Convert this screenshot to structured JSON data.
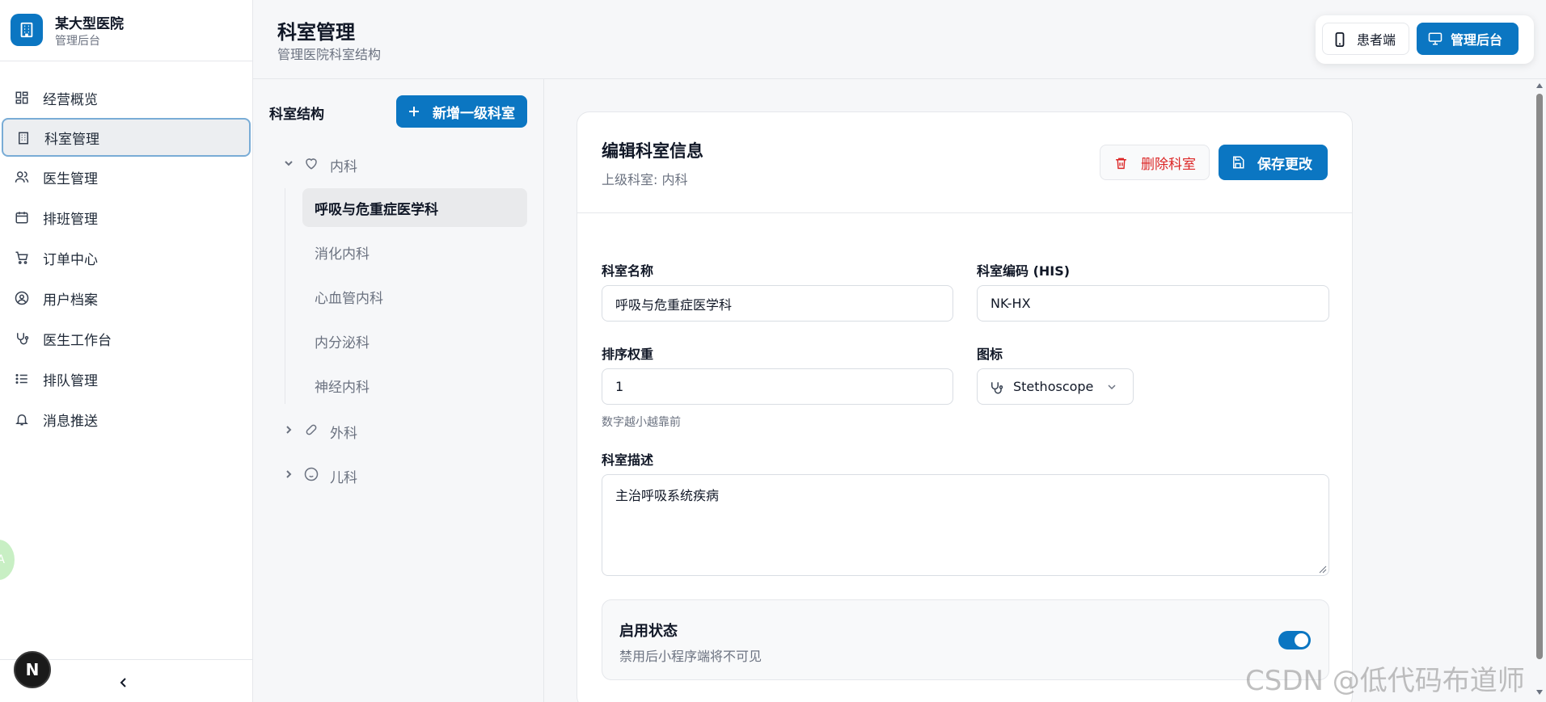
{
  "brand": {
    "title": "某大型医院",
    "subtitle": "管理后台"
  },
  "sidebar": {
    "items": [
      {
        "label": "经营概览",
        "icon": "dashboard-icon",
        "active": false
      },
      {
        "label": "科室管理",
        "icon": "building-icon",
        "active": true
      },
      {
        "label": "医生管理",
        "icon": "users-icon",
        "active": false
      },
      {
        "label": "排班管理",
        "icon": "calendar-icon",
        "active": false
      },
      {
        "label": "订单中心",
        "icon": "cart-icon",
        "active": false
      },
      {
        "label": "用户档案",
        "icon": "user-circle-icon",
        "active": false
      },
      {
        "label": "医生工作台",
        "icon": "stethoscope-icon",
        "active": false
      },
      {
        "label": "排队管理",
        "icon": "list-icon",
        "active": false
      },
      {
        "label": "消息推送",
        "icon": "bell-icon",
        "active": false
      }
    ],
    "collapse_glyph": "‹",
    "next_badge": "N"
  },
  "header": {
    "title": "科室管理",
    "subtitle": "管理医院科室结构",
    "switcher": {
      "patient_label": "患者端",
      "admin_label": "管理后台"
    }
  },
  "tree": {
    "title": "科室结构",
    "add_root_label": "新增一级科室",
    "nodes": [
      {
        "label": "内科",
        "icon": "heart-icon",
        "expanded": true,
        "children": [
          "呼吸与危重症医学科",
          "消化内科",
          "心血管内科",
          "内分泌科",
          "神经内科"
        ]
      },
      {
        "label": "外科",
        "icon": "bandage-icon",
        "expanded": false,
        "children": []
      },
      {
        "label": "儿科",
        "icon": "baby-icon",
        "expanded": false,
        "children": []
      }
    ],
    "selected_child": "呼吸与危重症医学科"
  },
  "editor": {
    "title": "编辑科室信息",
    "parent_text": "上级科室: 内科",
    "delete_label": "删除科室",
    "save_label": "保存更改",
    "fields": {
      "name_label": "科室名称",
      "name_value": "呼吸与危重症医学科",
      "code_label": "科室编码 (HIS)",
      "code_value": "NK-HX",
      "order_label": "排序权重",
      "order_value": "1",
      "order_hint": "数字越小越靠前",
      "icon_label": "图标",
      "icon_value": "Stethoscope",
      "desc_label": "科室描述",
      "desc_value": "主治呼吸系统疾病"
    },
    "status": {
      "title": "启用状态",
      "subtitle": "禁用后小程序端将不可见",
      "enabled": true
    }
  },
  "watermark": "CSDN @低代码布道师",
  "colors": {
    "primary": "#0b76c2",
    "danger": "#dc2626",
    "active_outline": "#79acd6"
  }
}
